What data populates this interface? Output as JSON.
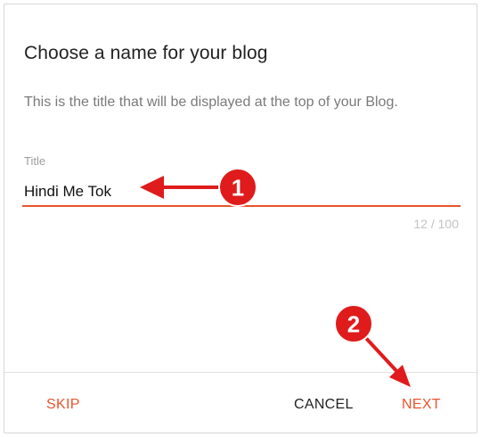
{
  "dialog": {
    "title": "Choose a name for your blog",
    "subtitle": "This is the title that will be displayed at the top of your Blog.",
    "field": {
      "label": "Title",
      "value": "Hindi Me Tok",
      "counter": "12 / 100"
    },
    "actions": {
      "skip_label": "SKIP",
      "cancel_label": "CANCEL",
      "next_label": "NEXT"
    }
  },
  "annotations": {
    "step1": "1",
    "step2": "2"
  },
  "colors": {
    "accent": "#e8542b",
    "annotation_red": "#e01b1b"
  }
}
